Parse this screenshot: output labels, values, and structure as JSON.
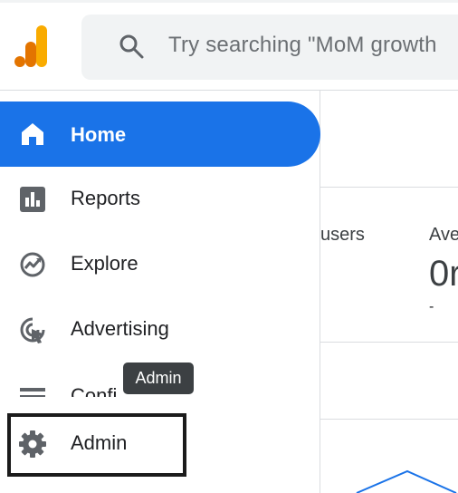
{
  "header": {
    "logo_icon": "analytics-logo-icon",
    "search": {
      "icon": "search-icon",
      "placeholder": "Try searching \"MoM growth"
    }
  },
  "sidebar": {
    "items": [
      {
        "label": "Home",
        "icon": "home-icon",
        "active": true
      },
      {
        "label": "Reports",
        "icon": "reports-icon"
      },
      {
        "label": "Explore",
        "icon": "explore-icon"
      },
      {
        "label": "Advertising",
        "icon": "advertising-icon"
      },
      {
        "label": "Confi",
        "icon": "configure-icon"
      },
      {
        "label": "Admin",
        "icon": "gear-icon"
      }
    ]
  },
  "tooltip": {
    "text": "Admin"
  },
  "main": {
    "metric_users_label": "users",
    "metric_ave_label": "Ave",
    "metric_ave_value": "0r",
    "metric_ave_change": "-"
  },
  "colors": {
    "accent": "#1a73e8",
    "logo_orange": "#f9ab00",
    "logo_dark_orange": "#e37400"
  }
}
